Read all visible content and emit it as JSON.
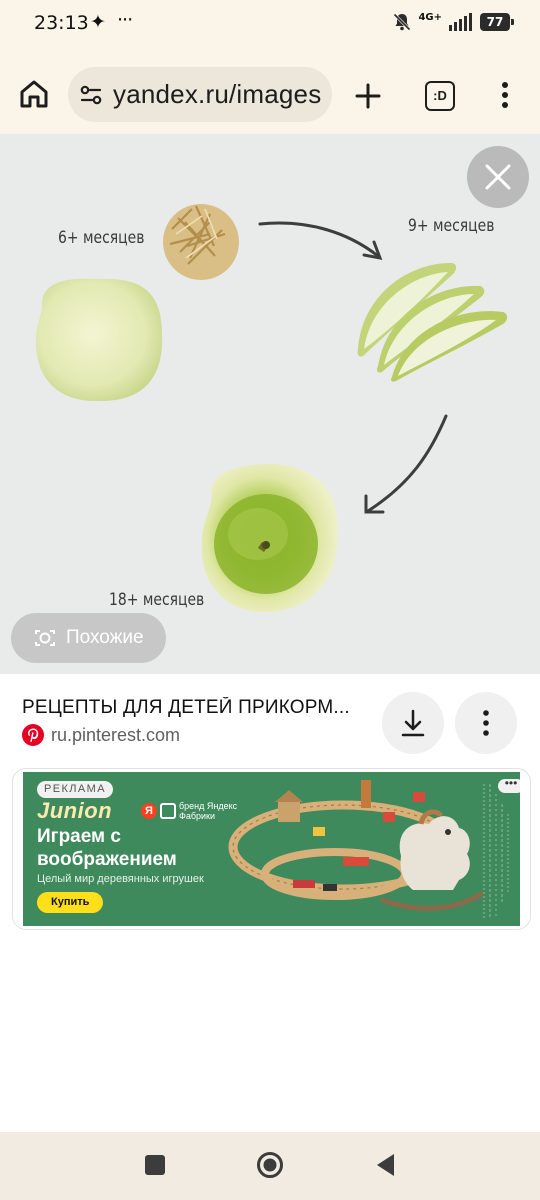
{
  "status_bar": {
    "time": "23:13",
    "spark_glyph": "✦",
    "dots_glyph": "···",
    "network": "4G+",
    "battery": "77",
    "icons": [
      "mute-icon",
      "signal-icon",
      "battery-icon"
    ]
  },
  "browser": {
    "url": "yandex.ru/images",
    "tabs_label": ":D",
    "icons": [
      "home-icon",
      "site-settings-icon",
      "plus-icon",
      "tabs-icon",
      "overflow-menu-icon"
    ]
  },
  "image": {
    "label_6": "6+ месяцев",
    "label_9": "9+ месяцев",
    "label_18": "18+ месяцев",
    "similar_label": "Похожие",
    "background_color": "#e9ebea"
  },
  "result": {
    "title": "РЕЦЕПТЫ ДЛЯ ДЕТЕЙ ПРИКОРМ...",
    "source": "ru.pinterest.com",
    "icons": [
      "pinterest-icon",
      "download-icon",
      "more-vertical-icon"
    ]
  },
  "ad": {
    "tag": "РЕКЛАМА",
    "brand": "Junion",
    "ya_letter": "Я",
    "brand_note": "бренд Яндекс Фабрики",
    "headline": "Играем с воображением",
    "subtitle": "Целый мир деревянных игрушек",
    "cta": "Купить",
    "options_glyph": "•••",
    "colors": {
      "background": "#3e8a5c",
      "button": "#ffde1a",
      "brand": "#fbe9b0"
    }
  },
  "navbar": {
    "icons": [
      "recent-apps-icon",
      "home-circle-icon",
      "back-icon"
    ]
  }
}
